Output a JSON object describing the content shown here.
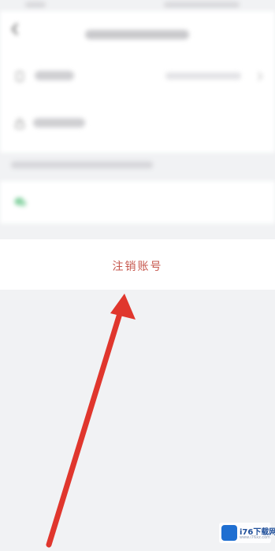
{
  "status_bar": {
    "time": "",
    "indicators": ""
  },
  "header": {
    "back_icon": "back-arrow-icon",
    "title": ""
  },
  "account_rows": [
    {
      "label": "",
      "value": "",
      "icon": "phone-icon"
    },
    {
      "label": "",
      "icon": "lock-icon"
    }
  ],
  "section": {
    "title": ""
  },
  "third_party": {
    "label": "",
    "icon": "wechat-icon"
  },
  "delete_account": {
    "label": "注销账号",
    "color": "#c6574d"
  },
  "annotation": {
    "arrow_color": "#e0362d",
    "icon": "red-pointer-arrow"
  },
  "watermark": {
    "text": "i76下载网",
    "subtext": "www.i76xz.com",
    "icon": "i76-logo-icon"
  },
  "colors": {
    "background": "#f1f2f4",
    "card": "#ffffff",
    "accent": "#c6574d"
  }
}
